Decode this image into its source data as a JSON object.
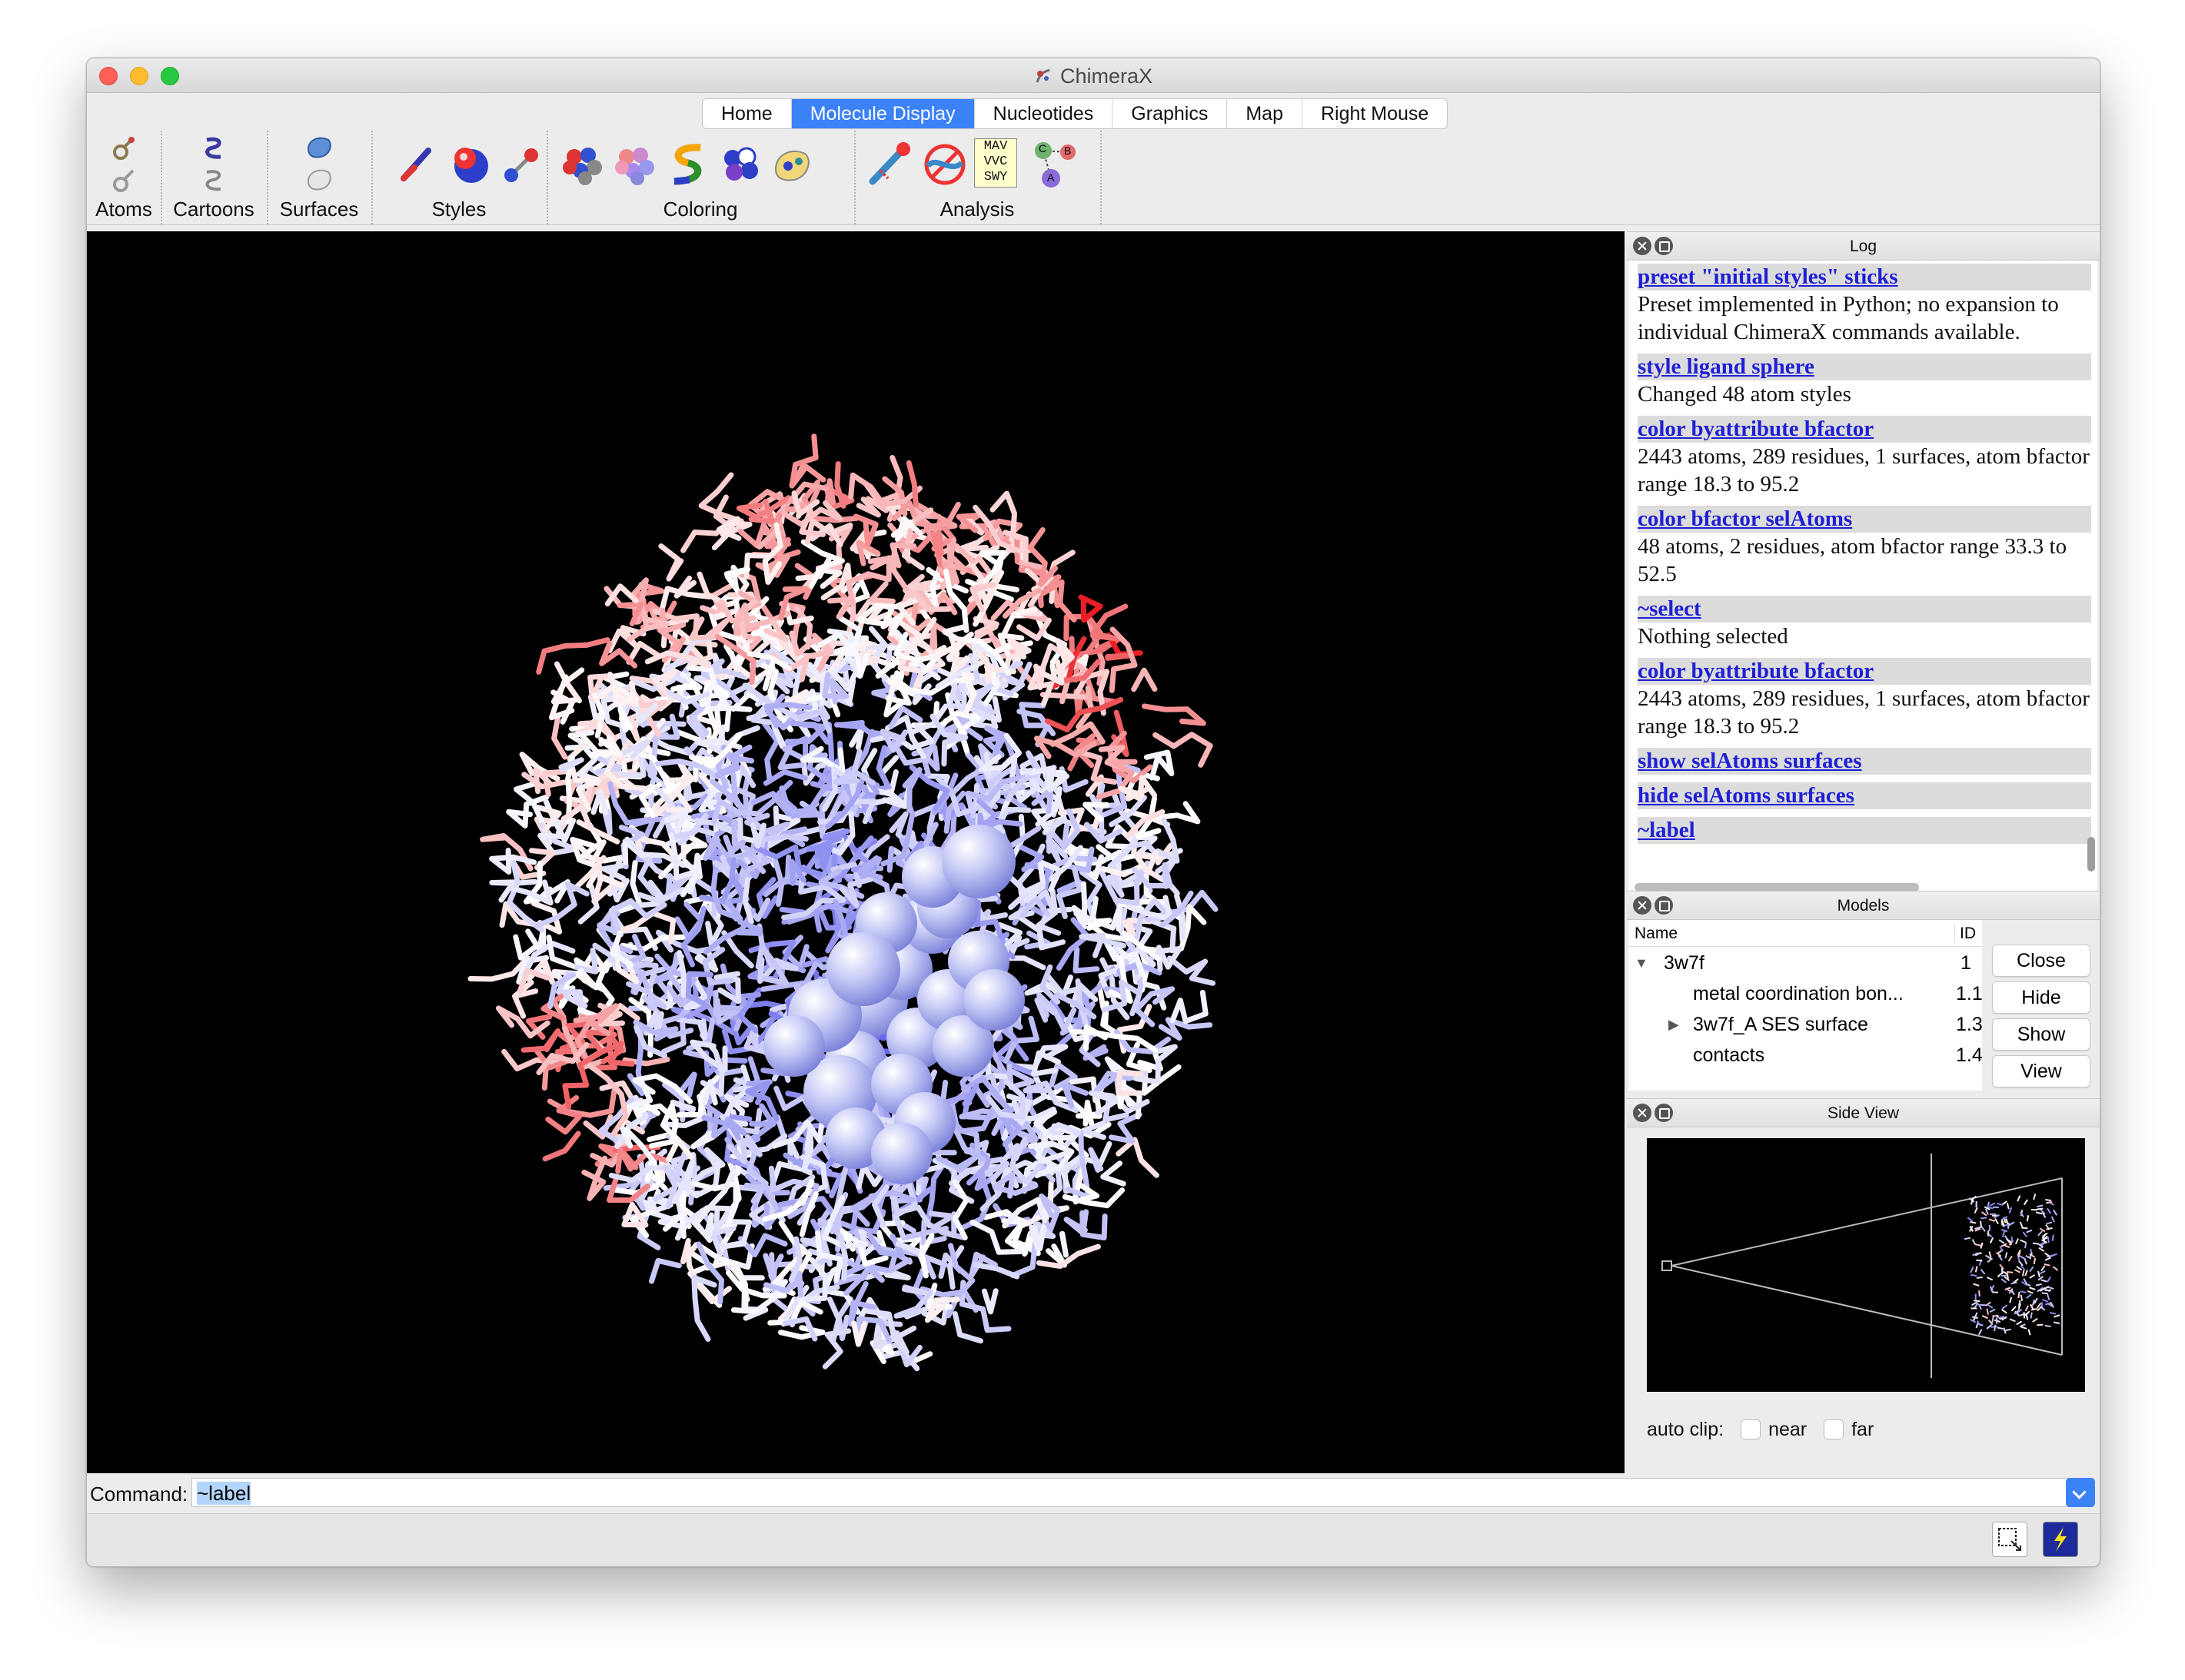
{
  "window": {
    "title": "ChimeraX"
  },
  "tabs": [
    "Home",
    "Molecule Display",
    "Nucleotides",
    "Graphics",
    "Map",
    "Right Mouse"
  ],
  "active_tab": "Molecule Display",
  "toolbar": {
    "groups": {
      "atoms": "Atoms",
      "cartoons": "Cartoons",
      "surfaces": "Surfaces",
      "styles": "Styles",
      "coloring": "Coloring",
      "analysis": "Analysis"
    },
    "sequence_icon_text": [
      "MAV",
      "VVC",
      "SWY"
    ],
    "chain_icon_letters": [
      "C",
      "B",
      "A"
    ]
  },
  "log": {
    "title": "Log",
    "entries": [
      {
        "cmd": "preset \"initial styles\" sticks",
        "out": "Preset implemented in Python; no expansion to individual ChimeraX commands available."
      },
      {
        "cmd": "style ligand sphere",
        "out": "Changed 48 atom styles"
      },
      {
        "cmd": "color byattribute bfactor",
        "out": "2443 atoms, 289 residues, 1 surfaces, atom bfactor range 18.3 to 95.2"
      },
      {
        "cmd": "color bfactor selAtoms",
        "out": "48 atoms, 2 residues, atom bfactor range 33.3 to 52.5"
      },
      {
        "cmd": "~select",
        "out": "Nothing selected"
      },
      {
        "cmd": "color byattribute bfactor",
        "out": "2443 atoms, 289 residues, 1 surfaces, atom bfactor range 18.3 to 95.2"
      },
      {
        "cmd": "show selAtoms surfaces",
        "out": ""
      },
      {
        "cmd": "hide selAtoms surfaces",
        "out": ""
      },
      {
        "cmd": "~label",
        "out": ""
      }
    ]
  },
  "models": {
    "title": "Models",
    "columns": {
      "name": "Name",
      "id": "ID"
    },
    "rows": [
      {
        "name": "3w7f",
        "id": "1"
      },
      {
        "name": "metal coordination bon...",
        "id": "1.1"
      },
      {
        "name": "3w7f_A SES surface",
        "id": "1.3"
      },
      {
        "name": "contacts",
        "id": "1.4"
      }
    ],
    "buttons": {
      "close": "Close",
      "hide": "Hide",
      "show": "Show",
      "view": "View"
    }
  },
  "side_view": {
    "title": "Side View",
    "auto_clip_label": "auto clip:",
    "near_label": "near",
    "far_label": "far",
    "near_checked": false,
    "far_checked": false
  },
  "command": {
    "label": "Command:",
    "value": "~label"
  },
  "colors": {
    "accent": "#3b82f7",
    "link": "#1f1fd6",
    "bfactor_low": "#4b4be6",
    "bfactor_mid": "#ffffff",
    "bfactor_high": "#e8151b"
  }
}
